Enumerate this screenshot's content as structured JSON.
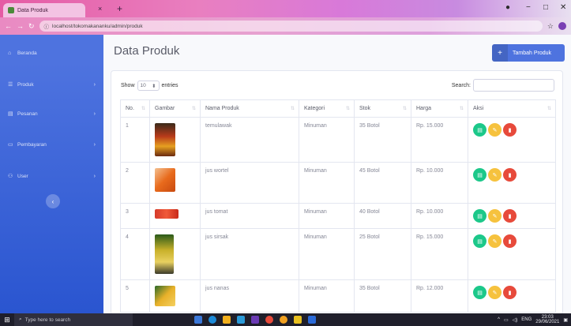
{
  "browser": {
    "tab_title": "Data Produk",
    "tab_close": "×",
    "tab_new": "+",
    "url": "localhost/tokomakananku/admin/produk",
    "win_min": "−",
    "win_max": "□",
    "win_close": "✕"
  },
  "sidebar": {
    "items": [
      {
        "label": "Beranda",
        "icon": "home-icon"
      },
      {
        "label": "Produk",
        "icon": "list-icon"
      },
      {
        "label": "Pesanan",
        "icon": "cart-icon"
      },
      {
        "label": "Pembayaran",
        "icon": "payment-icon"
      },
      {
        "label": "User",
        "icon": "user-icon"
      }
    ],
    "toggle_icon": "‹"
  },
  "page": {
    "title": "Data Produk",
    "add_button": "Tambah Produk"
  },
  "table_controls": {
    "show_label": "Show",
    "entries_value": "10",
    "entries_label": "entries",
    "search_label": "Search:"
  },
  "table": {
    "headers": [
      "No.",
      "Gambar",
      "Nama Produk",
      "Kategori",
      "Stok",
      "Harga",
      "Aksi"
    ],
    "rows": [
      {
        "no": "1",
        "nama": "temulawak",
        "kategori": "Minuman",
        "stok": "35 Botol",
        "harga": "Rp. 15.000",
        "img_color": "#b83a1a"
      },
      {
        "no": "2",
        "nama": "jus wortel",
        "kategori": "Minuman",
        "stok": "45 Botol",
        "harga": "Rp. 10.000",
        "img_color": "#e86a1c"
      },
      {
        "no": "3",
        "nama": "jus tomat",
        "kategori": "Minuman",
        "stok": "40 Botol",
        "harga": "Rp. 10.000",
        "img_color": "#d63b2a"
      },
      {
        "no": "4",
        "nama": "jus sirsak",
        "kategori": "Minuman",
        "stok": "25 Botol",
        "harga": "Rp. 15.000",
        "img_color": "#c9b12a"
      },
      {
        "no": "5",
        "nama": "jus nanas",
        "kategori": "Minuman",
        "stok": "35 Botol",
        "harga": "Rp. 12.000",
        "img_color": "#e8b12a"
      }
    ]
  },
  "taskbar": {
    "search_placeholder": "Type here to search",
    "lang": "ENG",
    "time": "23:03",
    "date": "29/06/2021"
  },
  "colors": {
    "primary": "#4e73df",
    "success": "#1cc88a",
    "warning": "#f6c23e",
    "danger": "#e74a3b"
  }
}
